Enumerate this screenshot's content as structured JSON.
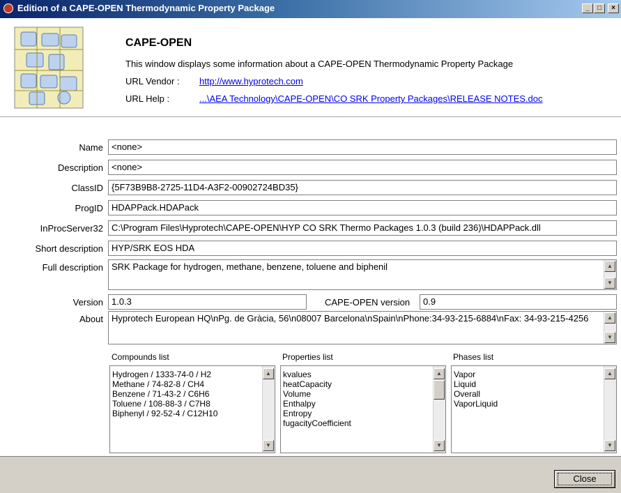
{
  "window": {
    "title": "Edition of a CAPE-OPEN Thermodynamic Property Package"
  },
  "header": {
    "title": "CAPE-OPEN",
    "description": "This window displays some information about a CAPE-OPEN Thermodynamic Property Package",
    "url_vendor_label": "URL Vendor :",
    "url_vendor": "http://www.hyprotech.com",
    "url_help_label": "URL Help :",
    "url_help": "...\\AEA Technology\\CAPE-OPEN\\CO SRK Property Packages\\RELEASE NOTES.doc"
  },
  "fields": {
    "name_label": "Name",
    "name": "<none>",
    "description_label": "Description",
    "description": "<none>",
    "classid_label": "ClassID",
    "classid": "{5F73B9B8-2725-11D4-A3F2-00902724BD35}",
    "progid_label": "ProgID",
    "progid": "HDAPPack.HDAPack",
    "inproc_label": "InProcServer32",
    "inproc": "C:\\Program Files\\Hyprotech\\CAPE-OPEN\\HYP CO SRK Thermo Packages 1.0.3 (build 236)\\HDAPPack.dll",
    "short_label": "Short description",
    "short": "HYP/SRK EOS HDA",
    "full_label": "Full description",
    "full": "SRK Package for hydrogen, methane, benzene, toluene and biphenil",
    "version_label": "Version",
    "version": "1.0.3",
    "capeopen_version_label": "CAPE-OPEN version",
    "capeopen_version": "0.9",
    "about_label": "About",
    "about": "Hyprotech European HQ\\nPg. de Gràcia, 56\\n08007 Barcelona\\nSpain\\nPhone:34-93-215-6884\\nFax: 34-93-215-4256"
  },
  "lists": {
    "compounds_label": "Compounds list",
    "compounds": [
      "Hydrogen / 1333-74-0 / H2",
      "Methane / 74-82-8 / CH4",
      "Benzene / 71-43-2 / C6H6",
      "Toluene / 108-88-3 / C7H8",
      "Biphenyl / 92-52-4 / C12H10"
    ],
    "properties_label": "Properties list",
    "properties": [
      "kvalues",
      "heatCapacity",
      "Volume",
      "Enthalpy",
      "Entropy",
      "fugacityCoefficient"
    ],
    "phases_label": "Phases list",
    "phases": [
      "Vapor",
      "Liquid",
      "Overall",
      "VaporLiquid"
    ]
  },
  "footer": {
    "close_label": "Close"
  },
  "colors": {
    "titlebar_start": "#0a246a",
    "titlebar_end": "#a6caf0",
    "link": "#0000ee",
    "face": "#d4d0c8"
  }
}
